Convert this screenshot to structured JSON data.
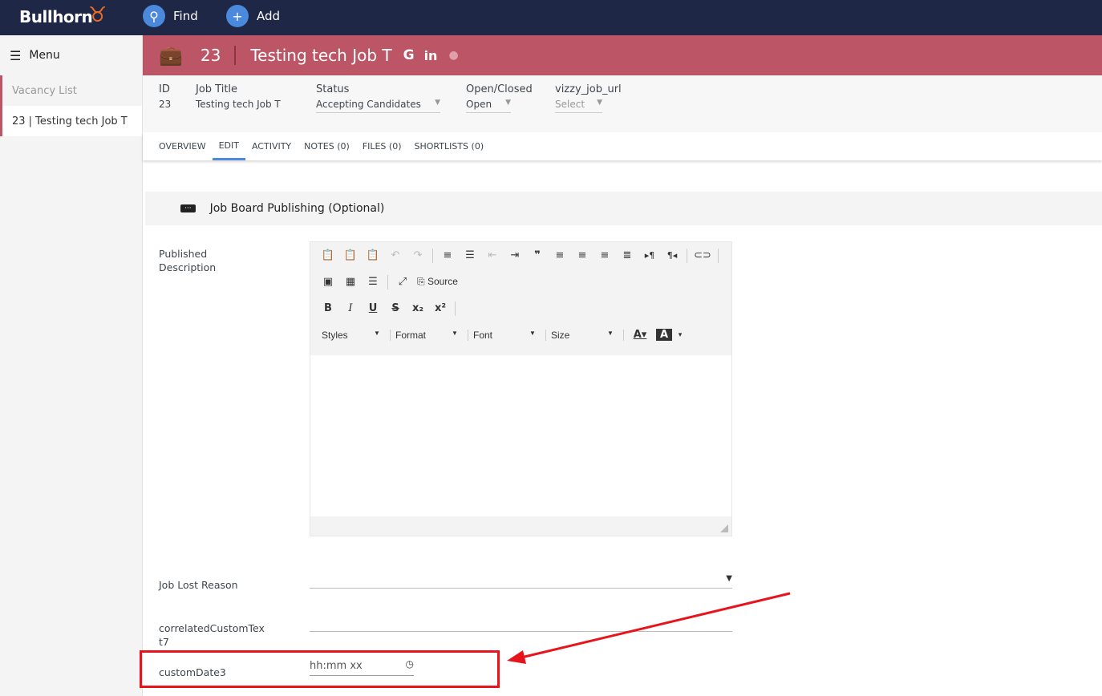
{
  "topbar": {
    "logo": "Bullhorn",
    "find": "Find",
    "add": "Add"
  },
  "sidebar": {
    "menu": "Menu",
    "items": [
      {
        "label": "Vacancy List"
      },
      {
        "label": "23 | Testing tech Job T"
      }
    ]
  },
  "header": {
    "id": "23",
    "title": "Testing tech Job T",
    "google": "G",
    "linkedin": "in"
  },
  "info": {
    "id_label": "ID",
    "id_value": "23",
    "title_label": "Job Title",
    "title_value": "Testing tech Job T",
    "status_label": "Status",
    "status_value": "Accepting Candidates",
    "open_label": "Open/Closed",
    "open_value": "Open",
    "url_label": "vizzy_job_url",
    "url_value": "Select"
  },
  "tabs": [
    "OVERVIEW",
    "EDIT",
    "ACTIVITY",
    "NOTES (0)",
    "FILES (0)",
    "SHORTLISTS (0)"
  ],
  "section": {
    "title": "Job Board Publishing (Optional)"
  },
  "editor": {
    "label": "Published Description",
    "source": "Source",
    "styles": "Styles",
    "format": "Format",
    "font": "Font",
    "size": "Size"
  },
  "fields": {
    "job_lost_reason": "Job Lost Reason",
    "correlated": "correlatedCustomText7",
    "custom_date": "customDate3",
    "custom_date_placeholder": "hh:mm xx"
  },
  "colors": {
    "topbar": "#1f2746",
    "header": "#bc5565",
    "accent": "#4a89dc",
    "annotation": "#e8141b"
  }
}
